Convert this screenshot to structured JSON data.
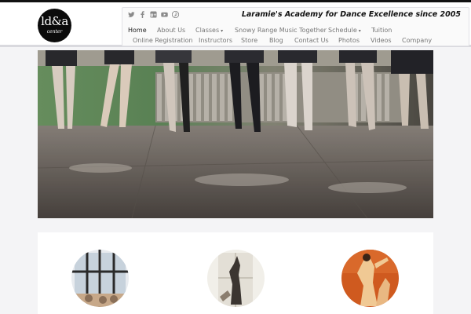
{
  "logo": {
    "line1": "ld&a",
    "line2": "center"
  },
  "tagline": "Laramie's Academy for Dance Excellence since 2005",
  "social_icons": [
    "twitter-icon",
    "facebook-icon",
    "google-plus-icon",
    "youtube-icon",
    "pinterest-icon"
  ],
  "nav": {
    "row1": [
      {
        "label": "Home",
        "active": true
      },
      {
        "label": "About Us"
      },
      {
        "label": "Classes",
        "dropdown": true
      },
      {
        "label": "Snowy Range Music Together"
      },
      {
        "label": "Schedule",
        "dropdown": true
      },
      {
        "label": "Tuition"
      }
    ],
    "row2": [
      {
        "label": "Online Registration"
      },
      {
        "label": "Instructors"
      },
      {
        "label": "Store"
      },
      {
        "label": "Blog"
      },
      {
        "label": "Contact Us"
      },
      {
        "label": "Photos"
      },
      {
        "label": "Videos"
      },
      {
        "label": "Company"
      }
    ]
  },
  "colors": {
    "accent_dark": "#111111",
    "nav_text": "#777777",
    "hero_floor": "#6f6862",
    "wall_green": "#5f8a5a"
  },
  "caret": "▾"
}
